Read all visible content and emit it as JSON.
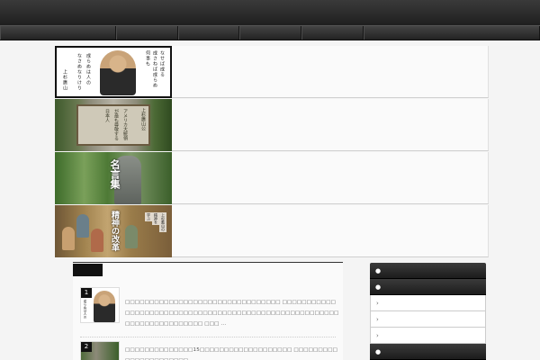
{
  "nav": {
    "item_count": 6
  },
  "slides": [
    {
      "id": "uesugi-quote",
      "lines": [
        "なせば成る",
        "成さねば成らぬ",
        "何事も",
        "成らぬは人の",
        "なさぬなりけり",
        "上杉鷹山"
      ]
    },
    {
      "id": "signboard",
      "title": "上杉鷹山公",
      "lines": [
        "アメリカ大統領",
        "が最も尊敬する",
        "日本人"
      ]
    },
    {
      "id": "statue",
      "big": "名言集"
    },
    {
      "id": "painting",
      "big": "精神の改革",
      "lines": [
        "上杉鷹山の",
        "精神を",
        "学ぶ"
      ]
    }
  ],
  "main": {
    "tab_label": "",
    "posts": [
      {
        "number": "1",
        "thumb_caption": "成らぬは人の",
        "text": "□□□□□□□□□□□□□□□□□□□□□□□□□□□□□□□□ □□□□□□□□□□□ □□□□□□□□□□□□□□□□□□□□□□□□□□□□□□□□□□□□□□□□□□□□□□□□□□□□□□□□□□□□ □□□ ..."
      },
      {
        "number": "2",
        "text": "□□□□□□□□□□□□□□15□□□□□□□□□□□□□□□□□□□ □□□□□□□□□□□□□□□□□□□□□□"
      }
    ]
  },
  "sidebar": {
    "heads": [
      "",
      ""
    ],
    "items": [
      "›",
      "›",
      "›"
    ],
    "head3": ""
  },
  "colors": {
    "dark": "#1f1f1f",
    "panel": "#fafafa",
    "bg": "#f4f4f4"
  }
}
